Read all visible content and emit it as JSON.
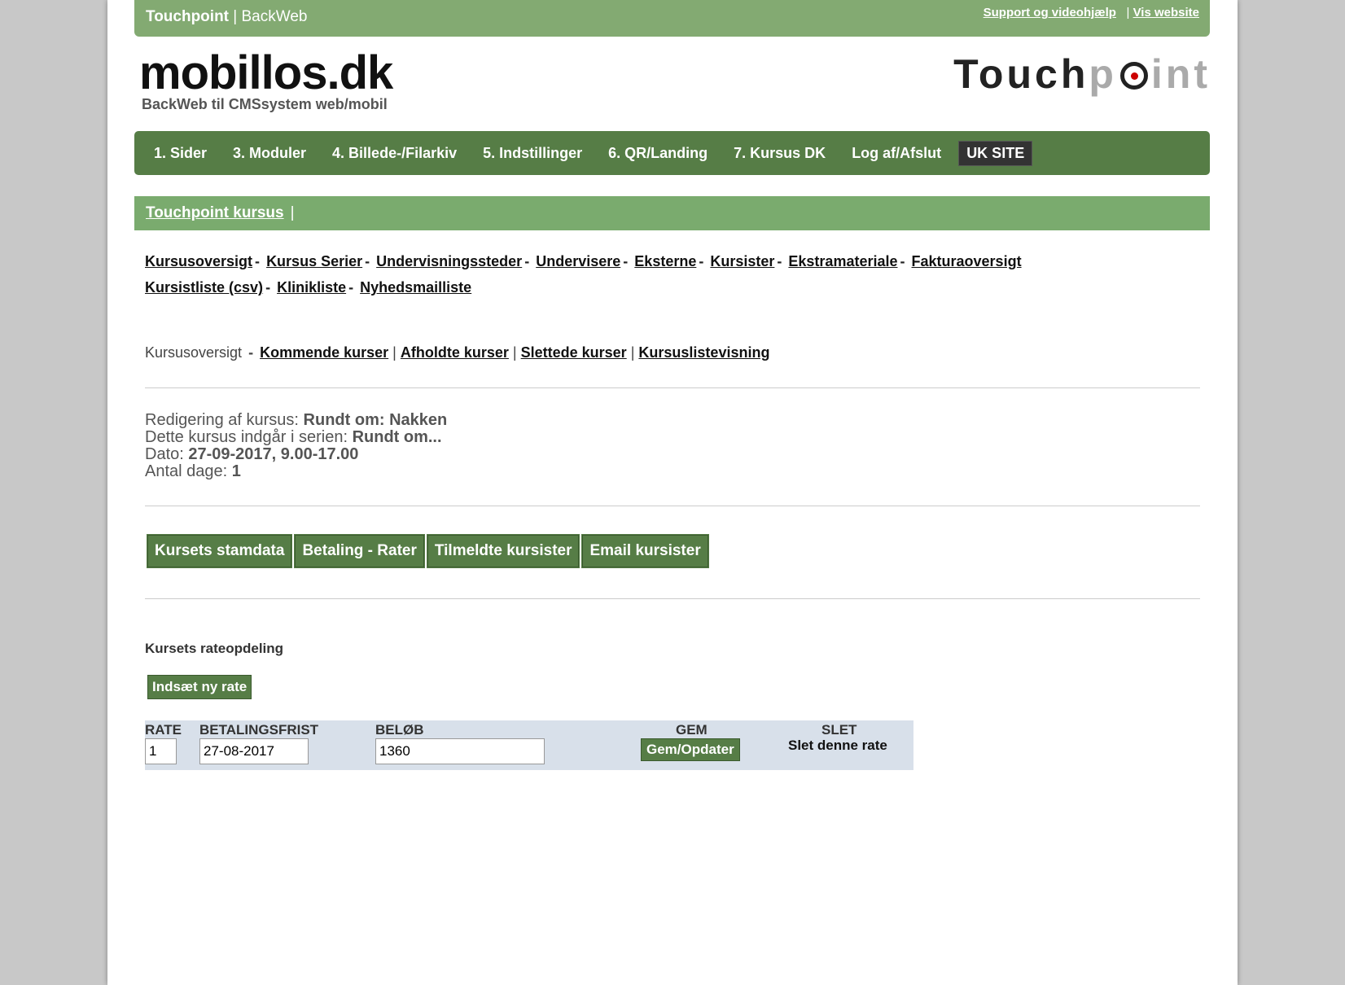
{
  "topbar": {
    "brand_bold": "Touchpoint",
    "brand_rest": " | BackWeb",
    "support_link": "Support og videohjælp",
    "divider": "|",
    "vis_link": "Vis website"
  },
  "logo_left": {
    "title": "mobillos.dk",
    "subtitle": "BackWeb til CMSsystem web/mobil"
  },
  "logo_right": {
    "dark": "Touch",
    "p": "p",
    "light": "int"
  },
  "mainnav": {
    "items": [
      "1. Sider",
      "3. Moduler",
      "4. Billede-/Filarkiv",
      "5. Indstillinger",
      "6. QR/Landing",
      "7. Kursus DK",
      "Log af/Afslut"
    ],
    "uk": "UK SITE"
  },
  "subbar": {
    "title": "Touchpoint kursus",
    "divider": "|"
  },
  "sublinks": {
    "row1": [
      "Kursusoversigt",
      "Kursus Serier",
      "Undervisningssteder",
      "Undervisere",
      "Eksterne",
      "Kursister",
      "Ekstramateriale",
      "Fakturaoversigt"
    ],
    "row2": [
      "Kursistliste (csv)",
      "Klinikliste",
      "Nyhedsmailliste"
    ],
    "sep": "-"
  },
  "breadcrumb": {
    "current": "Kursusoversigt",
    "dash": "-",
    "links": [
      "Kommende kurser",
      "Afholdte kurser",
      "Slettede kurser",
      "Kursuslistevisning"
    ],
    "pipe": "|"
  },
  "info": {
    "edit_label": "Redigering af kursus: ",
    "edit_value": "Rundt om: Nakken",
    "series_label": "Dette kursus indgår i serien: ",
    "series_value": "Rundt om...",
    "date_label": "Dato: ",
    "date_value": "27-09-2017, 9.00-17.00",
    "days_label": "Antal dage: ",
    "days_value": "1"
  },
  "tabs": [
    "Kursets stamdata",
    "Betaling - Rater",
    "Tilmeldte kursister",
    "Email kursister"
  ],
  "rates": {
    "title": "Kursets rateopdeling",
    "new_button": "Indsæt ny rate",
    "headers": {
      "rate": "RATE",
      "frist": "BETALINGSFRIST",
      "belob": "BELØB",
      "gem": "GEM",
      "slet": "SLET"
    },
    "row": {
      "rate": "1",
      "frist": "27-08-2017",
      "belob": "1360",
      "gem_button": "Gem/Opdater",
      "slet_link": "Slet denne rate"
    }
  }
}
